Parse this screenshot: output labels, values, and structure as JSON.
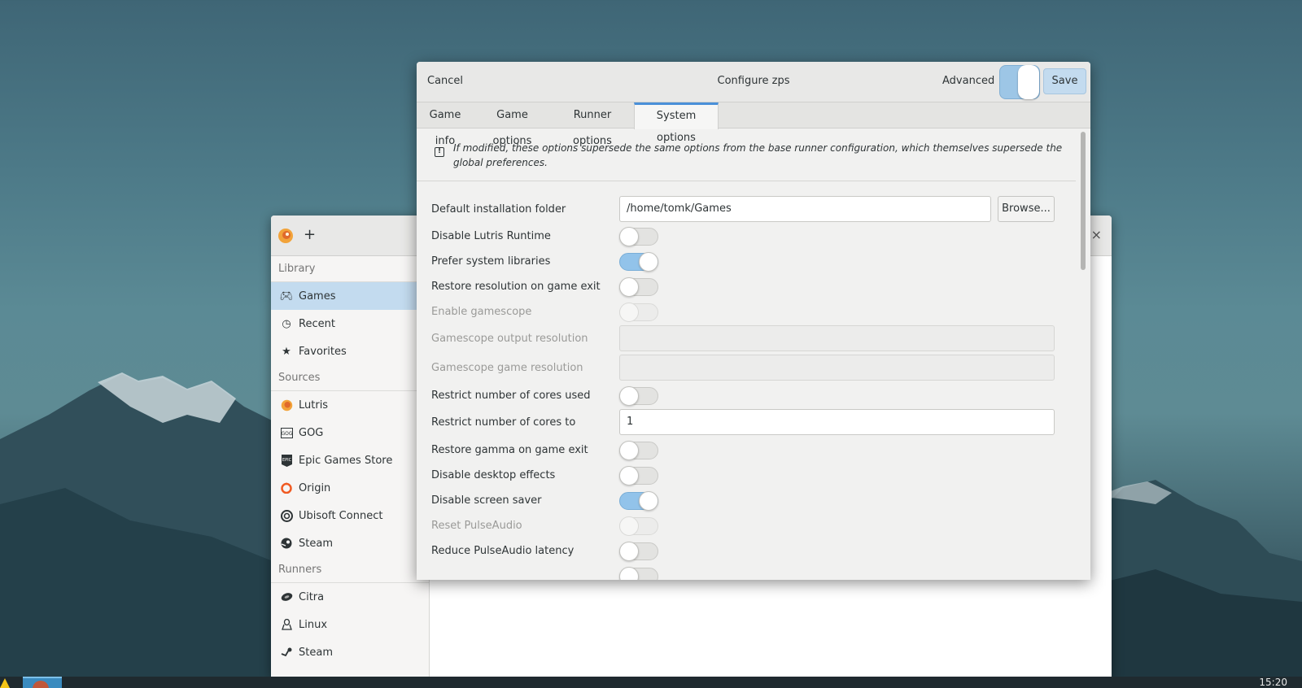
{
  "taskbar": {
    "clock": "15:20"
  },
  "main_window": {
    "sidebar": {
      "library_header": "Library",
      "library_items": [
        {
          "label": "Games",
          "icon": "gamepad-icon"
        },
        {
          "label": "Recent",
          "icon": "clock-icon"
        },
        {
          "label": "Favorites",
          "icon": "star-icon"
        }
      ],
      "sources_header": "Sources",
      "sources_items": [
        {
          "label": "Lutris",
          "icon": "lutris-icon"
        },
        {
          "label": "GOG",
          "icon": "gog-icon"
        },
        {
          "label": "Epic Games Store",
          "icon": "epic-icon"
        },
        {
          "label": "Origin",
          "icon": "origin-icon"
        },
        {
          "label": "Ubisoft Connect",
          "icon": "ubisoft-icon"
        },
        {
          "label": "Steam",
          "icon": "steam-icon"
        }
      ],
      "runners_header": "Runners",
      "runners_items": [
        {
          "label": "Citra",
          "icon": "citra-icon"
        },
        {
          "label": "Linux",
          "icon": "linux-icon"
        },
        {
          "label": "Steam",
          "icon": "steam-icon"
        }
      ]
    }
  },
  "dialog": {
    "cancel_label": "Cancel",
    "title": "Configure zps",
    "advanced_label": "Advanced",
    "advanced_on": true,
    "save_label": "Save",
    "tabs": [
      {
        "label": "Game info",
        "active": false
      },
      {
        "label": "Game options",
        "active": false
      },
      {
        "label": "Runner options",
        "active": false
      },
      {
        "label": "System options",
        "active": true
      }
    ],
    "notice": "If modified, these options supersede the same options from the base runner configuration, which themselves supersede the global preferences.",
    "browse_label": "Browse...",
    "options": {
      "default_folder": {
        "label": "Default installation folder",
        "value": "/home/tomk/Games"
      },
      "disable_runtime": {
        "label": "Disable Lutris Runtime",
        "on": false
      },
      "prefer_system_libs": {
        "label": "Prefer system libraries",
        "on": true
      },
      "restore_resolution": {
        "label": "Restore resolution on game exit",
        "on": false
      },
      "enable_gamescope": {
        "label": "Enable gamescope",
        "on": false,
        "disabled": true
      },
      "gamescope_output_res": {
        "label": "Gamescope output resolution",
        "value": "",
        "disabled": true
      },
      "gamescope_game_res": {
        "label": "Gamescope game resolution",
        "value": "",
        "disabled": true
      },
      "restrict_cores": {
        "label": "Restrict number of cores used",
        "on": false
      },
      "restrict_cores_to": {
        "label": "Restrict number of cores to",
        "value": "1"
      },
      "restore_gamma": {
        "label": "Restore gamma on game exit",
        "on": false
      },
      "disable_desktop_effects": {
        "label": "Disable desktop effects",
        "on": false
      },
      "disable_screen_saver": {
        "label": "Disable screen saver",
        "on": true
      },
      "reset_pulseaudio": {
        "label": "Reset PulseAudio",
        "on": false,
        "disabled": true
      },
      "reduce_pulse_latency": {
        "label": "Reduce PulseAudio latency",
        "on": false
      }
    }
  }
}
